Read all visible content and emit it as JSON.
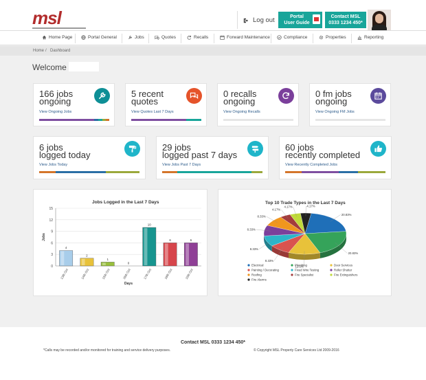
{
  "header": {
    "logo_text": "msl",
    "logout_label": "Log out",
    "portal_label_1": "Portal",
    "portal_label_2": "User Guide",
    "contact_label_1": "Contact MSL",
    "contact_label_2": "0333 1234 450*"
  },
  "nav": {
    "items": [
      {
        "label": "Home Page",
        "icon": "home-icon"
      },
      {
        "label": "Portal General",
        "icon": "globe-icon"
      },
      {
        "label": "Jobs",
        "icon": "wrench-icon"
      },
      {
        "label": "Quotes",
        "icon": "chat-icon"
      },
      {
        "label": "Recalls",
        "icon": "refresh-icon"
      },
      {
        "label": "Forward Maintenance",
        "icon": "calendar-icon"
      },
      {
        "label": "Compliance",
        "icon": "check-icon"
      },
      {
        "label": "Properties",
        "icon": "gear-icon"
      },
      {
        "label": "Reporting",
        "icon": "chart-icon"
      }
    ]
  },
  "breadcrumb": {
    "home": "Home",
    "sep": "/",
    "current": "Dashboard"
  },
  "welcome": "Welcome",
  "cards_top": [
    {
      "line1": "166 jobs",
      "line2": "ongoing",
      "link": "View Ongoing Jobs",
      "icon_color": "#0e8f96",
      "icon": "wrench-icon"
    },
    {
      "line1": "5 recent",
      "line2": "quotes",
      "link": "View Quotes Last 7 Days",
      "icon_color": "#e5532a",
      "icon": "chat-icon"
    },
    {
      "line1": "0 recalls",
      "line2": "ongoing",
      "link": "View Ongoing Recalls",
      "icon_color": "#7b3f9b",
      "icon": "refresh-icon"
    },
    {
      "line1": "0 fm jobs",
      "line2": "ongoing",
      "link": "View Ongoing FM Jobs",
      "icon_color": "#5b4a9c",
      "icon": "calendar-icon"
    }
  ],
  "cards_mid": [
    {
      "line1": "6 jobs",
      "line2": "logged today",
      "link": "View Jobs Today",
      "icon_color": "#1fb5c9",
      "icon": "paint-roller-icon"
    },
    {
      "line1": "29 jobs",
      "line2": "logged past 7 days",
      "link": "View Jobs Past 7 Days",
      "icon_color": "#1fb5c9",
      "icon": "signpost-icon"
    },
    {
      "line1": "60 jobs",
      "line2": "recently completed",
      "link": "View Recently Completed Jobs",
      "icon_color": "#1fb5c9",
      "icon": "thumbs-up-icon"
    }
  ],
  "colors": {
    "teal": "#18a59a",
    "red": "#b22c2c",
    "link": "#2b5a8a"
  },
  "chart_data": [
    {
      "type": "bar",
      "title": "Jobs Logged in the Last 7 Days",
      "xlabel": "Days",
      "ylabel": "Jobs",
      "categories": [
        "13th Oct",
        "14th Oct",
        "15th Oct",
        "16th Oct",
        "17th Oct",
        "18th Oct",
        "19th Oct"
      ],
      "values": [
        4,
        2,
        1,
        0,
        10,
        6,
        6
      ],
      "colors": [
        "#a8cdea",
        "#e8c23a",
        "#98bf3c",
        "#999999",
        "#17958f",
        "#d6454b",
        "#8f3f96"
      ],
      "ylim": [
        0,
        15
      ],
      "yticks": [
        0,
        3,
        6,
        9,
        12,
        15
      ],
      "grid": true
    },
    {
      "type": "pie",
      "title": "Top 10 Trade Types in the Last 7 Days",
      "labels": [
        "Electrical",
        "Plumbing",
        "Door Services",
        "Painting / Decorating",
        "Fixed Wire Testing",
        "Roller Shutter",
        "Roofing",
        "Fire Specialist",
        "Fire Extinguishers",
        "Fire Alarms"
      ],
      "values": [
        20.83,
        20.83,
        12.5,
        8.33,
        8.33,
        8.33,
        8.33,
        4.17,
        4.17,
        4.17
      ],
      "slice_labels": [
        "20.83%",
        "20.83%",
        "12.5%",
        "8.33%",
        "8.33%",
        "8.33%",
        "8.33%",
        "4.17%",
        "4.17%",
        "4.17%"
      ],
      "colors": [
        "#1f6fb8",
        "#35a35a",
        "#e8c23a",
        "#d9534f",
        "#2bb5c9",
        "#7b3f9b",
        "#f0961e",
        "#a33c3c",
        "#c0da3a",
        "#222222"
      ],
      "legend_placement": "bottom"
    }
  ],
  "footer": {
    "contact": "Contact MSL 0333 1234 450*",
    "note": "*Calls may be recorded and/or monitored for training and service delivery purposes.",
    "copyright": "© Copyright MSL Property Care Services Ltd 2009-2016"
  }
}
